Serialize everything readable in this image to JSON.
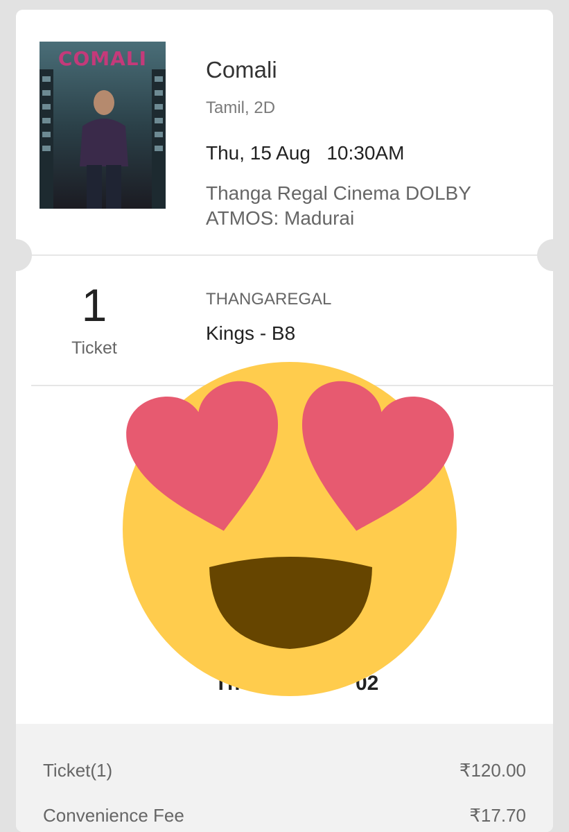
{
  "movie": {
    "poster_title": "COMALI",
    "title": "Comali",
    "language_format": "Tamil, 2D",
    "date": "Thu, 15 Aug",
    "time": "10:30AM",
    "venue": "Thanga Regal Cinema DOLBY ATMOS: Madurai"
  },
  "tickets": {
    "count": "1",
    "count_label": "Ticket",
    "screen": "THANGAREGAL",
    "seats": "Kings - B8"
  },
  "booking": {
    "partial_text": "Th                    02"
  },
  "summary": {
    "rows": [
      {
        "label": "Ticket(1)",
        "amount": "₹120.00"
      },
      {
        "label": "Convenience Fee",
        "amount": "₹17.70"
      }
    ]
  },
  "overlay": {
    "icon": "heart-eyes-emoji-icon",
    "colors": {
      "face": "#FFCC4D",
      "hearts": "#E75A70",
      "mouth": "#664500"
    }
  },
  "colors": {
    "background": "#e2e2e2",
    "card": "#ffffff",
    "summary_bg": "#f2f2f2"
  }
}
